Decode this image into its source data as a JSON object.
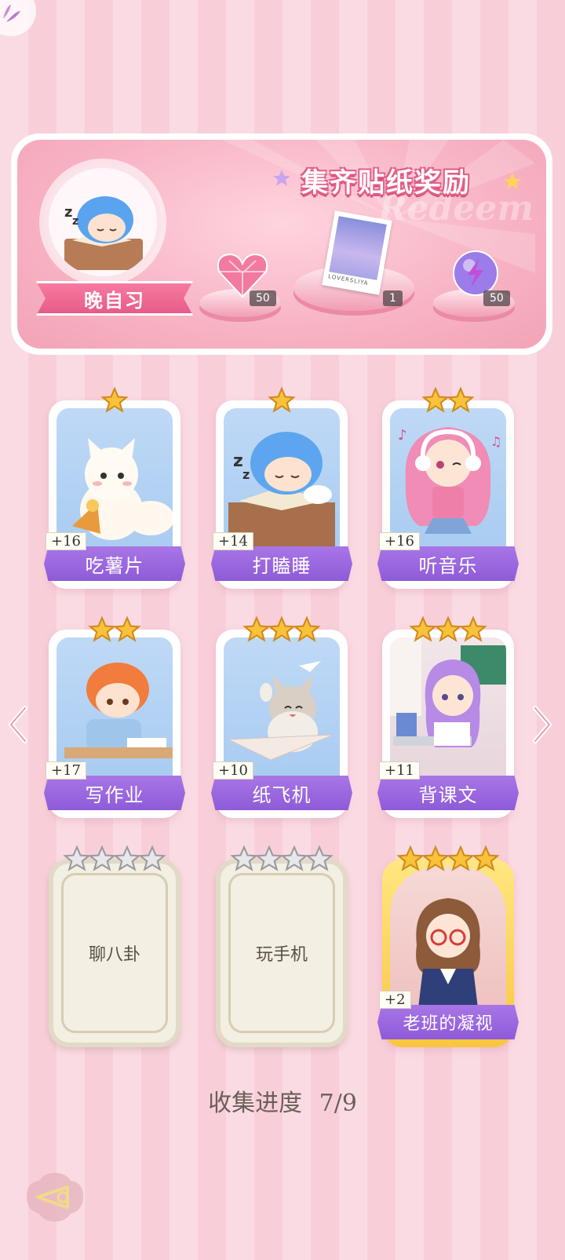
{
  "banner": {
    "title": "集齐贴纸奖励",
    "watermark": "Redeem",
    "character_name": "晚自习",
    "rewards": [
      {
        "icon": "heart-gem-icon",
        "count": "50"
      },
      {
        "icon": "photo-card-icon",
        "count": "1",
        "caption": "LOVERSLIYA"
      },
      {
        "icon": "lightning-orb-icon",
        "count": "50"
      }
    ]
  },
  "cards": [
    {
      "label": "吃薯片",
      "bonus": "+16",
      "stars": 1,
      "state": "collected"
    },
    {
      "label": "打瞌睡",
      "bonus": "+14",
      "stars": 1,
      "state": "collected"
    },
    {
      "label": "听音乐",
      "bonus": "+16",
      "stars": 2,
      "state": "collected"
    },
    {
      "label": "写作业",
      "bonus": "+17",
      "stars": 2,
      "state": "collected"
    },
    {
      "label": "纸飞机",
      "bonus": "+10",
      "stars": 3,
      "state": "collected"
    },
    {
      "label": "背课文",
      "bonus": "+11",
      "stars": 3,
      "state": "collected"
    },
    {
      "label": "聊八卦",
      "stars": 4,
      "state": "locked"
    },
    {
      "label": "玩手机",
      "stars": 4,
      "state": "locked"
    },
    {
      "label": "老班的凝视",
      "bonus": "+2",
      "stars": 4,
      "state": "collected-gold"
    }
  ],
  "progress": {
    "label": "收集进度",
    "value": "7/9"
  },
  "colors": {
    "accent_purple": "#9a66e0",
    "accent_pink": "#e75b88",
    "star_gold": "#f8c23a"
  }
}
